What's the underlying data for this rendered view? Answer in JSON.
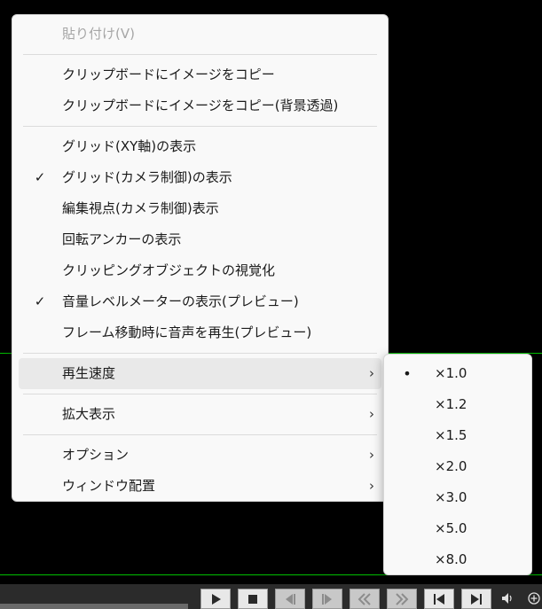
{
  "context_menu": {
    "items": [
      {
        "label": "貼り付け(V)",
        "disabled": true
      },
      {
        "label": "クリップボードにイメージをコピー"
      },
      {
        "label": "クリップボードにイメージをコピー(背景透過)"
      },
      {
        "label": "グリッド(XY軸)の表示",
        "checked": false
      },
      {
        "label": "グリッド(カメラ制御)の表示",
        "checked": true
      },
      {
        "label": "編集視点(カメラ制御)表示",
        "checked": false
      },
      {
        "label": "回転アンカーの表示",
        "checked": false
      },
      {
        "label": "クリッピングオブジェクトの視覚化",
        "checked": false
      },
      {
        "label": "音量レベルメーターの表示(プレビュー)",
        "checked": true
      },
      {
        "label": "フレーム移動時に音声を再生(プレビュー)",
        "checked": false
      },
      {
        "label": "再生速度",
        "submenu": true
      },
      {
        "label": "拡大表示",
        "submenu": true
      },
      {
        "label": "オプション",
        "submenu": true
      },
      {
        "label": "ウィンドウ配置",
        "submenu": true
      }
    ],
    "check_glyph": "✓",
    "arrow_glyph": "›"
  },
  "playback_speed_submenu": {
    "bullet_glyph": "•",
    "selected_index": 0,
    "items": [
      "×1.0",
      "×1.2",
      "×1.5",
      "×2.0",
      "×3.0",
      "×5.0",
      "×8.0"
    ]
  },
  "colors": {
    "menu_bg": "#f9f9f9",
    "highlight": "#e9e9e9",
    "grid_line": "#00c000",
    "text": "#1a1a1a",
    "disabled_text": "#a6a6a6"
  }
}
